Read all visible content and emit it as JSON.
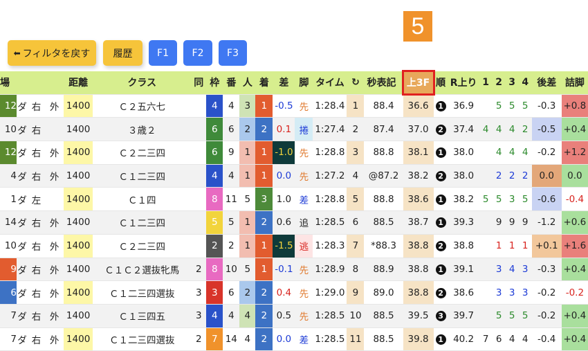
{
  "step_badge": "5",
  "toolbar": {
    "filter_back": "フィルタを戻す",
    "history": "履歴",
    "f1": "F1",
    "f2": "F2",
    "f3": "F3"
  },
  "table": {
    "headers": [
      "場",
      "",
      "",
      "",
      "距離",
      "クラス",
      "同",
      "枠",
      "番",
      "人",
      "着",
      "差",
      "脚",
      "タイム",
      "↻",
      "秒表記",
      "上3F",
      "順",
      "R上り",
      "1",
      "2",
      "3",
      "4",
      "後差",
      "詰脚"
    ],
    "rows": [
      {
        "ba": "12",
        "baColor": "#5b8a2e",
        "surf": "ダ",
        "turn": "右",
        "io": "外",
        "dist": "1400",
        "cls": "Ｃ２五六七",
        "same": "",
        "waku": "4",
        "wakuColor": "#2a52c9",
        "ban": "4",
        "nin": "3",
        "ninColor": "#cfe3b5",
        "chaku": "1",
        "chakuColor": "#e25c2f",
        "diff": "-0.5",
        "diffCls": "neg",
        "diffBg": "",
        "kyaku": "先",
        "kyakuColor": "#e07b30",
        "kyakuBg": "",
        "time": "1:28.4",
        "rnk": "1",
        "sec": "88.4",
        "up3f": "36.6",
        "jun": "1",
        "rup": "36.9",
        "c1": "",
        "c2": "5",
        "c3": "5",
        "c4": "5",
        "cColor": "green",
        "ato": "-0.3",
        "atoBg": "",
        "tsume": "+0.8",
        "tsumeBg": "#e9807b"
      },
      {
        "ba": "10",
        "baColor": "",
        "surf": "ダ",
        "turn": "右",
        "io": "",
        "dist": "1400",
        "cls": "３歳２",
        "same": "",
        "waku": "6",
        "wakuColor": "#3f8a3a",
        "ban": "6",
        "nin": "2",
        "ninColor": "#aac8ec",
        "chaku": "2",
        "chakuColor": "#3d72c4",
        "diff": "0.1",
        "diffCls": "pos",
        "diffBg": "",
        "kyaku": "捲",
        "kyakuColor": "#1d3bd6",
        "kyakuBg": "#d4ecf5",
        "time": "1:27.4",
        "rnk": "2",
        "sec": "87.4",
        "up3f": "37.0",
        "jun": "2",
        "rup": "37.4",
        "c1": "4",
        "c2": "4",
        "c3": "4",
        "c4": "2",
        "cColor": "green",
        "ato": "-0.5",
        "atoBg": "#c9d3f3",
        "tsume": "+0.4",
        "tsumeBg": "#a9df9d"
      },
      {
        "ba": "12",
        "baColor": "#5b8a2e",
        "surf": "ダ",
        "turn": "右",
        "io": "外",
        "dist": "1400",
        "cls": "Ｃ２二三四",
        "same": "",
        "waku": "6",
        "wakuColor": "#3f8a3a",
        "ban": "9",
        "nin": "1",
        "ninColor": "#f2bdb0",
        "chaku": "1",
        "chakuColor": "#e25c2f",
        "diff": "-1.0",
        "diffCls": "",
        "diffBg": "#0f3a3a",
        "kyaku": "先",
        "kyakuColor": "#e07b30",
        "kyakuBg": "",
        "time": "1:28.8",
        "rnk": "3",
        "sec": "88.8",
        "up3f": "38.1",
        "jun": "1",
        "rup": "38.0",
        "c1": "",
        "c2": "4",
        "c3": "4",
        "c4": "4",
        "cColor": "green",
        "ato": "-0.2",
        "atoBg": "",
        "tsume": "+1.2",
        "tsumeBg": "#e9807b"
      },
      {
        "ba": "4",
        "baColor": "",
        "surf": "ダ",
        "turn": "右",
        "io": "外",
        "dist": "1400",
        "cls": "Ｃ１二三四",
        "same": "",
        "waku": "4",
        "wakuColor": "#2a52c9",
        "ban": "4",
        "nin": "1",
        "ninColor": "#f2bdb0",
        "chaku": "1",
        "chakuColor": "#e25c2f",
        "diff": "0.0",
        "diffCls": "neg",
        "diffBg": "",
        "kyaku": "先",
        "kyakuColor": "#e07b30",
        "kyakuBg": "",
        "time": "1:27.2",
        "rnk": "4",
        "sec": "@87.2",
        "up3f": "38.2",
        "jun": "2",
        "rup": "38.0",
        "c1": "",
        "c2": "2",
        "c3": "2",
        "c4": "2",
        "cColor": "blue",
        "ato": "0.0",
        "atoBg": "#e3a779",
        "tsume": "0.0",
        "tsumeBg": "#a9df9d"
      },
      {
        "ba": "1",
        "baColor": "",
        "surf": "ダ",
        "turn": "左",
        "io": "",
        "dist": "1400",
        "cls": "Ｃ１四",
        "same": "",
        "waku": "8",
        "wakuColor": "#e86ac1",
        "ban": "11",
        "nin": "5",
        "ninColor": "",
        "chaku": "3",
        "chakuColor": "#4d8a3a",
        "diff": "1.0",
        "diffCls": "",
        "diffBg": "",
        "kyaku": "差",
        "kyakuColor": "#1d3bd6",
        "kyakuBg": "",
        "time": "1:28.8",
        "rnk": "5",
        "sec": "88.8",
        "up3f": "38.6",
        "jun": "1",
        "rup": "38.2",
        "c1": "5",
        "c2": "5",
        "c3": "3",
        "c4": "5",
        "cColor": "green",
        "ato": "-0.6",
        "atoBg": "#c9d3f3",
        "tsume": "-0.4",
        "tsumeBg": ""
      },
      {
        "ba": "14",
        "baColor": "",
        "surf": "ダ",
        "turn": "右",
        "io": "外",
        "dist": "1400",
        "cls": "Ｃ１二三四",
        "same": "",
        "waku": "5",
        "wakuColor": "#f2d43c",
        "ban": "5",
        "nin": "1",
        "ninColor": "#f2bdb0",
        "chaku": "2",
        "chakuColor": "#3d72c4",
        "diff": "0.6",
        "diffCls": "",
        "diffBg": "",
        "kyaku": "追",
        "kyakuColor": "#222",
        "kyakuBg": "#f2f2f2",
        "time": "1:28.5",
        "rnk": "6",
        "sec": "88.5",
        "up3f": "38.7",
        "jun": "1",
        "rup": "39.3",
        "c1": "",
        "c2": "9",
        "c3": "9",
        "c4": "9",
        "cColor": "",
        "ato": "-1.2",
        "atoBg": "",
        "tsume": "+0.6",
        "tsumeBg": "#a9df9d"
      },
      {
        "ba": "10",
        "baColor": "",
        "surf": "ダ",
        "turn": "右",
        "io": "外",
        "dist": "1400",
        "cls": "Ｃ２二三四",
        "same": "",
        "waku": "2",
        "wakuColor": "#555555",
        "ban": "2",
        "nin": "1",
        "ninColor": "#f2bdb0",
        "chaku": "1",
        "chakuColor": "#e25c2f",
        "diff": "-1.5",
        "diffCls": "",
        "diffBg": "#0f3a3a",
        "kyaku": "逃",
        "kyakuColor": "#d8231e",
        "kyakuBg": "#fde4e4",
        "time": "1:28.3",
        "rnk": "7",
        "sec": "*88.3",
        "up3f": "38.8",
        "jun": "2",
        "rup": "38.8",
        "c1": "",
        "c2": "1",
        "c3": "1",
        "c4": "1",
        "cColor": "red",
        "ato": "+0.1",
        "atoBg": "#f2c79b",
        "tsume": "+1.6",
        "tsumeBg": "#e9807b"
      },
      {
        "ba": "9",
        "baColor": "#e25c2f",
        "surf": "ダ",
        "turn": "右",
        "io": "外",
        "dist": "1400",
        "cls": "Ｃ１Ｃ２選抜牝馬",
        "same": "2",
        "waku": "8",
        "wakuColor": "#e86ac1",
        "ban": "10",
        "nin": "5",
        "ninColor": "",
        "chaku": "1",
        "chakuColor": "#e25c2f",
        "diff": "-0.1",
        "diffCls": "neg",
        "diffBg": "",
        "kyaku": "先",
        "kyakuColor": "#e07b30",
        "kyakuBg": "",
        "time": "1:28.9",
        "rnk": "8",
        "sec": "88.9",
        "up3f": "38.8",
        "jun": "1",
        "rup": "39.1",
        "c1": "",
        "c2": "3",
        "c3": "4",
        "c4": "3",
        "cColor": "blue",
        "ato": "-0.3",
        "atoBg": "",
        "tsume": "+0.4",
        "tsumeBg": "#a9df9d"
      },
      {
        "ba": "6",
        "baColor": "#3d72c4",
        "surf": "ダ",
        "turn": "右",
        "io": "外",
        "dist": "1400",
        "cls": "Ｃ１二三四選抜",
        "same": "3",
        "waku": "3",
        "wakuColor": "#d8342a",
        "ban": "6",
        "nin": "2",
        "ninColor": "#aac8ec",
        "chaku": "2",
        "chakuColor": "#3d72c4",
        "diff": "0.4",
        "diffCls": "pos",
        "diffBg": "",
        "kyaku": "先",
        "kyakuColor": "#e07b30",
        "kyakuBg": "",
        "time": "1:29.0",
        "rnk": "9",
        "sec": "89.0",
        "up3f": "38.8",
        "jun": "2",
        "rup": "38.6",
        "c1": "",
        "c2": "3",
        "c3": "3",
        "c4": "3",
        "cColor": "blue",
        "ato": "-0.2",
        "atoBg": "",
        "tsume": "-0.2",
        "tsumeBg": ""
      },
      {
        "ba": "7",
        "baColor": "",
        "surf": "ダ",
        "turn": "右",
        "io": "外",
        "dist": "1400",
        "cls": "Ｃ１三四五",
        "same": "3",
        "waku": "4",
        "wakuColor": "#2a52c9",
        "ban": "4",
        "nin": "4",
        "ninColor": "#cfe3b5",
        "chaku": "2",
        "chakuColor": "#3d72c4",
        "diff": "0.5",
        "diffCls": "",
        "diffBg": "",
        "kyaku": "先",
        "kyakuColor": "#e07b30",
        "kyakuBg": "",
        "time": "1:28.5",
        "rnk": "10",
        "sec": "88.5",
        "up3f": "39.5",
        "jun": "3",
        "rup": "39.7",
        "c1": "",
        "c2": "5",
        "c3": "5",
        "c4": "5",
        "cColor": "green",
        "ato": "-0.2",
        "atoBg": "",
        "tsume": "+0.4",
        "tsumeBg": "#a9df9d"
      },
      {
        "ba": "7",
        "baColor": "",
        "surf": "ダ",
        "turn": "右",
        "io": "外",
        "dist": "1400",
        "cls": "Ｃ１二三四選抜",
        "same": "2",
        "waku": "7",
        "wakuColor": "#f0922b",
        "ban": "14",
        "nin": "4",
        "ninColor": "",
        "chaku": "2",
        "chakuColor": "#3d72c4",
        "diff": "0.0",
        "diffCls": "neg",
        "diffBg": "",
        "kyaku": "差",
        "kyakuColor": "#1d3bd6",
        "kyakuBg": "",
        "time": "1:28.5",
        "rnk": "11",
        "sec": "88.5",
        "up3f": "39.8",
        "jun": "1",
        "rup": "40.2",
        "c1": "7",
        "c2": "6",
        "c3": "4",
        "c4": "4",
        "cColor": "",
        "ato": "-0.4",
        "atoBg": "",
        "tsume": "+0.4",
        "tsumeBg": "#a9df9d"
      }
    ]
  }
}
